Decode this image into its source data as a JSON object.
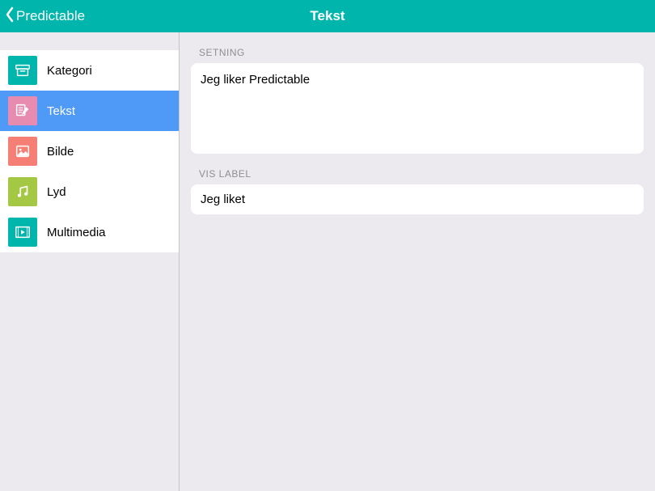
{
  "header": {
    "back_label": "Predictable",
    "title": "Tekst"
  },
  "sidebar": {
    "items": [
      {
        "id": "kategori",
        "label": "Kategori",
        "icon": "archive-icon",
        "icon_color": "#00b6ac",
        "selected": false
      },
      {
        "id": "tekst",
        "label": "Tekst",
        "icon": "edit-icon",
        "icon_color": "#e78cb0",
        "selected": true
      },
      {
        "id": "bilde",
        "label": "Bilde",
        "icon": "image-icon",
        "icon_color": "#f57f74",
        "selected": false
      },
      {
        "id": "lyd",
        "label": "Lyd",
        "icon": "music-icon",
        "icon_color": "#a4c843",
        "selected": false
      },
      {
        "id": "multimedia",
        "label": "Multimedia",
        "icon": "play-icon",
        "icon_color": "#00b6ac",
        "selected": false
      }
    ]
  },
  "content": {
    "section1_header": "SETNING",
    "setning_value": "Jeg liker Predictable",
    "section2_header": "VIS LABEL",
    "vis_label_value": "Jeg liket"
  },
  "colors": {
    "accent": "#00b6ac",
    "selected": "#4f99f7",
    "bg": "#eceaef"
  }
}
